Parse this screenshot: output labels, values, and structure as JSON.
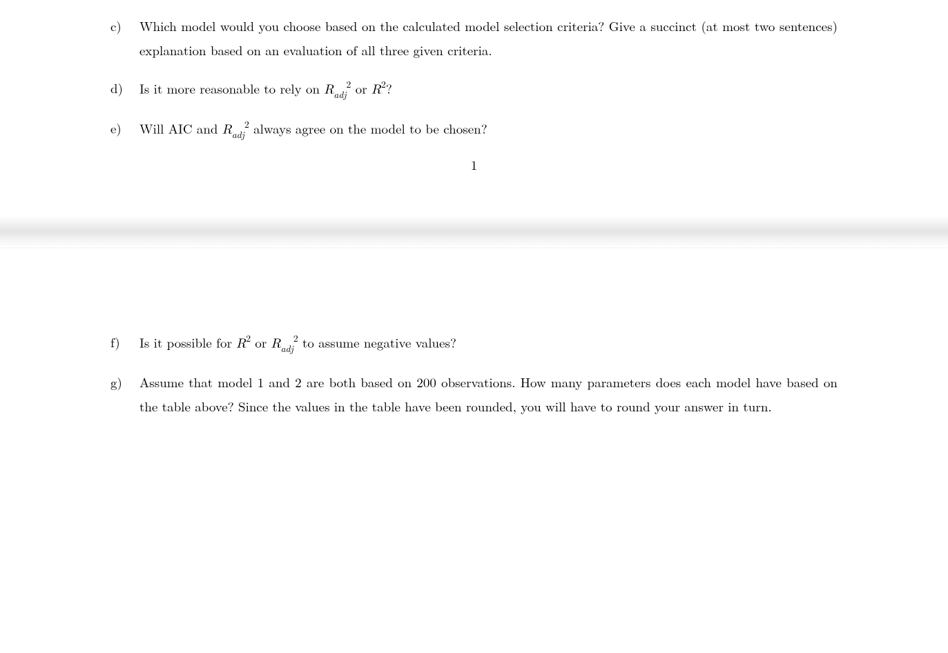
{
  "items": {
    "c": {
      "marker": "c)",
      "text": "Which model would you choose based on the calculated model selection criteria? Give a succinct (at most two sentences) explanation based on an evaluation of all three given criteria."
    },
    "d": {
      "marker": "d)",
      "prefix": "Is it more reasonable to rely on ",
      "or": " or ",
      "suffix": "?"
    },
    "e": {
      "marker": "e)",
      "prefix": "Will AIC and ",
      "suffix": " always agree on the model to be chosen?"
    },
    "f": {
      "marker": "f)",
      "prefix": "Is it possible for ",
      "or": " or ",
      "suffix": " to assume negative values?"
    },
    "g": {
      "marker": "g)",
      "text": "Assume that model 1 and 2 are both based on 200 observations. How many parameters does each model have based on the table above? Since the values in the table have been rounded, you will have to round your answer in turn."
    }
  },
  "math": {
    "R": "R",
    "adj": "adj",
    "two": "2"
  },
  "pageNumber": "1"
}
